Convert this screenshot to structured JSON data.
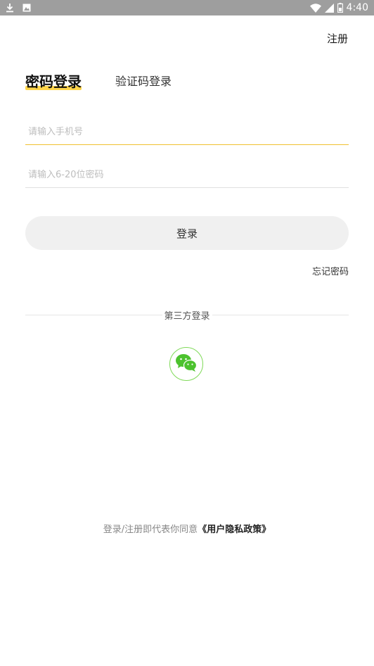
{
  "status_bar": {
    "time": "4:40",
    "icons": [
      "download-icon",
      "gallery-icon",
      "wifi-icon",
      "signal-icon",
      "battery-icon"
    ]
  },
  "header": {
    "register_label": "注册"
  },
  "tabs": {
    "active": "密码登录",
    "inactive": "验证码登录"
  },
  "form": {
    "phone_placeholder": "请输入手机号",
    "password_placeholder": "请输入6-20位密码",
    "login_label": "登录",
    "forgot_label": "忘记密码"
  },
  "third_party": {
    "label": "第三方登录",
    "icon": "wechat-icon"
  },
  "agreement": {
    "prefix": "登录/注册即代表你同意",
    "policy": "《用户隐私政策》"
  },
  "colors": {
    "accent": "#ffd54a",
    "wechat": "#7ed957",
    "status_bar": "#9e9e9e"
  }
}
